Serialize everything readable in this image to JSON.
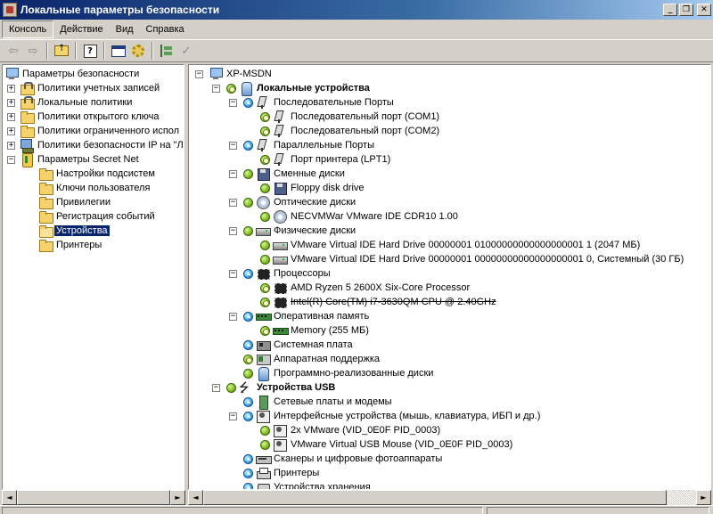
{
  "window": {
    "title": "Локальные параметры безопасности",
    "minimize": "_",
    "restore": "❐",
    "close": "✕"
  },
  "menu": [
    {
      "label": "Консоль"
    },
    {
      "label": "Действие"
    },
    {
      "label": "Вид"
    },
    {
      "label": "Справка"
    }
  ],
  "toolbar": {
    "back_icon": "arrow-left-icon",
    "forward_icon": "arrow-right-icon",
    "up_icon": "folder-up-icon",
    "help_icon": "help-icon",
    "new_window_icon": "new-window-icon",
    "properties_icon": "gear-icon",
    "tree_icon": "tree-icon",
    "apply_icon": "check-icon"
  },
  "left_tree": {
    "root": "Параметры безопасности",
    "items": [
      {
        "label": "Политики учетных записей",
        "expander": "+"
      },
      {
        "label": "Локальные политики",
        "expander": "+"
      },
      {
        "label": "Политики открытого ключа",
        "expander": "+"
      },
      {
        "label": "Политики ограниченного испол",
        "expander": "+"
      },
      {
        "label": "Политики безопасности IP на \"Л",
        "expander": "+"
      },
      {
        "label": "Параметры Secret Net",
        "expander": "−"
      }
    ],
    "secretnet_children": [
      {
        "label": "Настройки подсистем"
      },
      {
        "label": "Ключи пользователя"
      },
      {
        "label": "Привилегии"
      },
      {
        "label": "Регистрация событий"
      },
      {
        "label": "Устройства",
        "selected": true
      },
      {
        "label": "Принтеры"
      }
    ]
  },
  "right_tree": {
    "computer": "XP-MSDN",
    "local_devices": "Локальные устройства",
    "serial_ports": "Последовательные Порты",
    "com1": "Последовательный порт (COM1)",
    "com2": "Последовательный порт (COM2)",
    "parallel_ports": "Параллельные Порты",
    "lpt1": "Порт принтера (LPT1)",
    "removable": "Сменные диски",
    "floppy": "Floppy disk drive",
    "optical": "Оптические диски",
    "cdrom": "NECVMWar VMware IDE CDR10 1.00",
    "physical": "Физические диски",
    "hdd1": "VMware Virtual IDE Hard Drive 00000001 01000000000000000001 1 (2047 МБ)",
    "hdd2": "VMware Virtual IDE Hard Drive 00000001 00000000000000000001 0, Системный (30 ГБ)",
    "cpus": "Процессоры",
    "cpu1": "AMD Ryzen 5 2600X Six-Core Processor",
    "cpu2": "Intel(R) Core(TM) i7-3630QM CPU @ 2.40GHz",
    "ram": "Оперативная память",
    "memory": "Memory (255 МБ)",
    "motherboard": "Системная плата",
    "hw_support": "Аппаратная поддержка",
    "sw_disks": "Программно-реализованные диски",
    "usb": "Устройства USB",
    "netcards": "Сетевые платы и модемы",
    "hid": "Интерфейсные устройства (мышь, клавиатура, ИБП и др.)",
    "hid1": "2x VMware (VID_0E0F PID_0003)",
    "hid2": "VMware Virtual USB Mouse (VID_0E0F PID_0003)",
    "scanners": "Сканеры и цифровые фотоаппараты",
    "printers": "Принтеры",
    "storage": "Устройства хранения",
    "expand_minus": "−",
    "expand_plus": "+"
  },
  "colors": {
    "selection": "#0a246a",
    "titlebar": "#0a246a",
    "marker_green": "#7dbb1a",
    "marker_blue": "#3aa7e8"
  },
  "scroll": {
    "left_arrow": "◄",
    "right_arrow": "►"
  }
}
